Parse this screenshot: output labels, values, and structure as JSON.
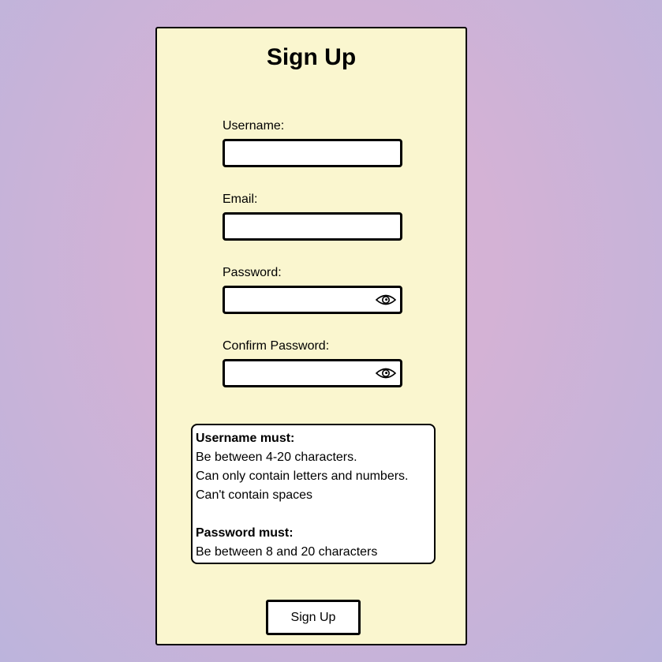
{
  "form": {
    "title": "Sign Up",
    "fields": [
      {
        "label": "Username:",
        "value": "",
        "placeholder": ""
      },
      {
        "label": "Email:",
        "value": "",
        "placeholder": ""
      },
      {
        "label": "Password:",
        "value": "",
        "placeholder": ""
      },
      {
        "label": "Confirm Password:",
        "value": "",
        "placeholder": ""
      }
    ],
    "submit_label": "Sign Up"
  },
  "rules": {
    "username_heading": "Username must:",
    "username_rules": [
      "Be between 4-20 characters.",
      "Can only contain letters and numbers.",
      "Can't contain spaces"
    ],
    "password_heading": "Password must:",
    "password_rules": [
      "Be between 8 and 20 characters"
    ]
  },
  "icons": {
    "password_toggle": "eye-icon",
    "confirm_password_toggle": "eye-icon"
  }
}
